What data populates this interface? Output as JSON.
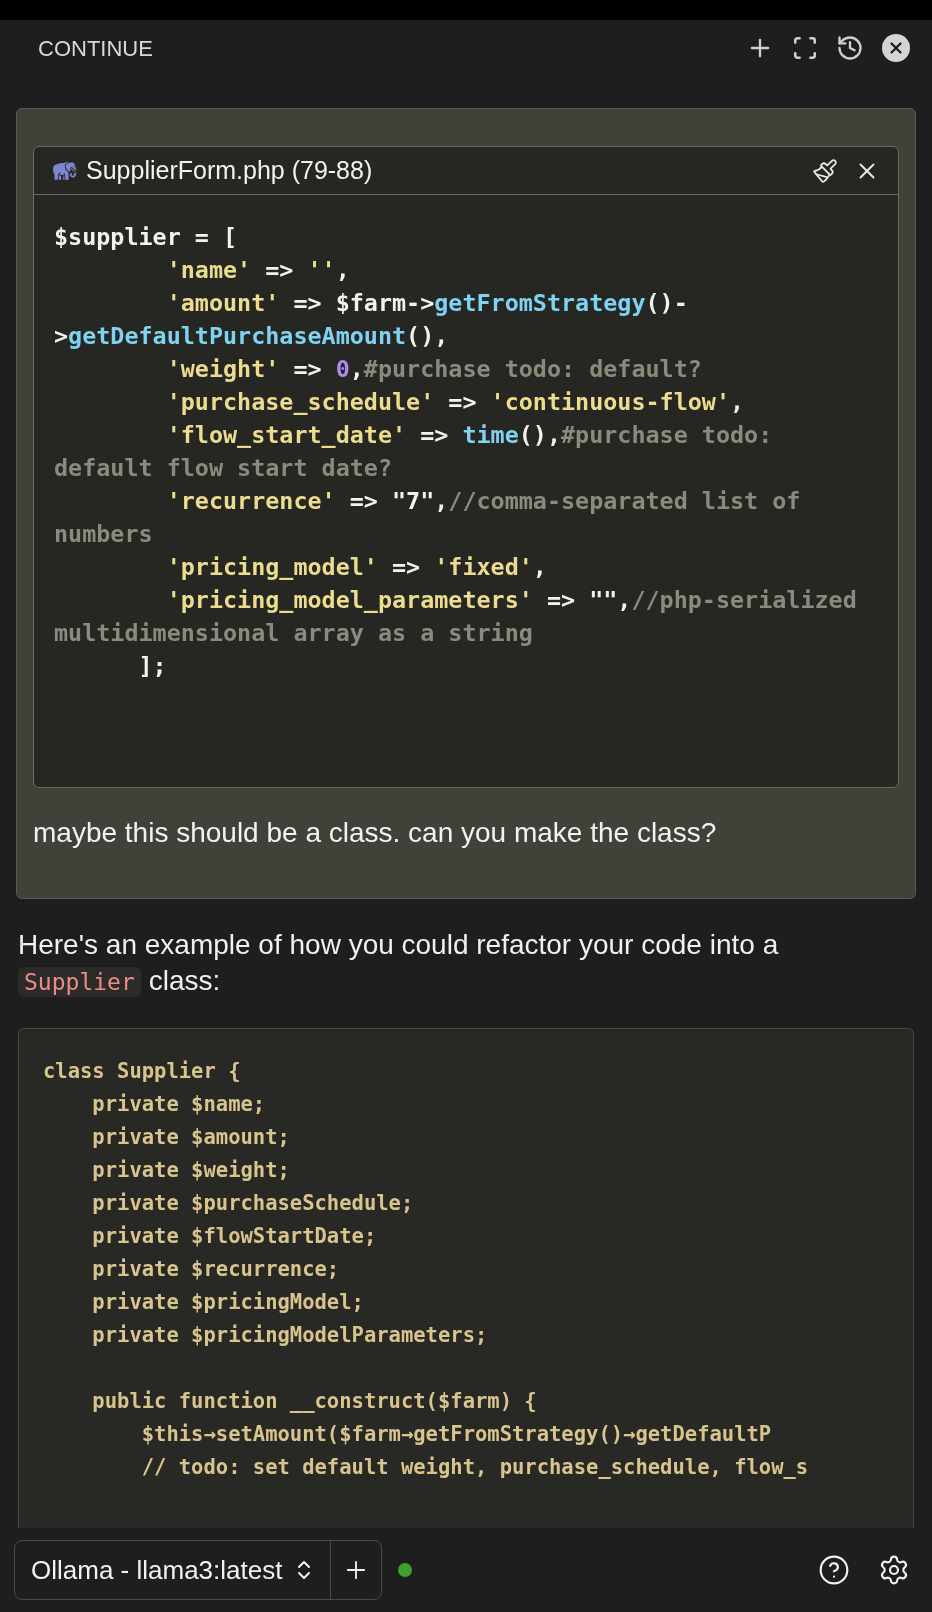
{
  "header": {
    "title": "CONTINUE"
  },
  "user_message": {
    "context": {
      "filename": "SupplierForm.php (79-88)",
      "code_lines": [
        {
          "indented": false,
          "tokens": [
            {
              "kind": "plain",
              "text": "$supplier = ["
            }
          ]
        },
        {
          "indented": true,
          "tokens": [
            {
              "kind": "string",
              "text": "'name'"
            },
            {
              "kind": "plain",
              "text": " => "
            },
            {
              "kind": "string",
              "text": "''"
            },
            {
              "kind": "plain",
              "text": ","
            }
          ]
        },
        {
          "indented": true,
          "tokens": [
            {
              "kind": "string",
              "text": "'amount'"
            },
            {
              "kind": "plain",
              "text": " => $farm->"
            },
            {
              "kind": "func",
              "text": "getFromStrategy"
            },
            {
              "kind": "plain",
              "text": "()-"
            }
          ]
        },
        {
          "indented": false,
          "tokens": [
            {
              "kind": "plain",
              "text": ">"
            },
            {
              "kind": "func",
              "text": "getDefaultPurchaseAmount"
            },
            {
              "kind": "plain",
              "text": "(),"
            }
          ]
        },
        {
          "indented": true,
          "tokens": [
            {
              "kind": "string",
              "text": "'weight'"
            },
            {
              "kind": "plain",
              "text": " => "
            },
            {
              "kind": "number",
              "text": "0"
            },
            {
              "kind": "plain",
              "text": ","
            },
            {
              "kind": "comment",
              "text": "#purchase todo: default?"
            }
          ]
        },
        {
          "indented": true,
          "tokens": [
            {
              "kind": "string",
              "text": "'purchase_schedule'"
            },
            {
              "kind": "plain",
              "text": " => "
            },
            {
              "kind": "string",
              "text": "'continuous-flow'"
            },
            {
              "kind": "plain",
              "text": ","
            }
          ]
        },
        {
          "indented": true,
          "tokens": [
            {
              "kind": "string",
              "text": "'flow_start_date'"
            },
            {
              "kind": "plain",
              "text": " => "
            },
            {
              "kind": "func",
              "text": "time"
            },
            {
              "kind": "plain",
              "text": "(),"
            },
            {
              "kind": "comment",
              "text": "#purchase todo:"
            }
          ]
        },
        {
          "indented": false,
          "tokens": [
            {
              "kind": "comment",
              "text": "default flow start date?"
            }
          ]
        },
        {
          "indented": true,
          "tokens": [
            {
              "kind": "string",
              "text": "'recurrence'"
            },
            {
              "kind": "plain",
              "text": " => \"7\","
            },
            {
              "kind": "comment",
              "text": "//comma-separated list of"
            }
          ]
        },
        {
          "indented": false,
          "tokens": [
            {
              "kind": "comment",
              "text": "numbers"
            }
          ]
        },
        {
          "indented": true,
          "tokens": [
            {
              "kind": "string",
              "text": "'pricing_model'"
            },
            {
              "kind": "plain",
              "text": " => "
            },
            {
              "kind": "string",
              "text": "'fixed'"
            },
            {
              "kind": "plain",
              "text": ","
            }
          ]
        },
        {
          "indented": true,
          "tokens": [
            {
              "kind": "string",
              "text": "'pricing_model_parameters'"
            },
            {
              "kind": "plain",
              "text": " => \"\","
            },
            {
              "kind": "comment",
              "text": "//php-serialized"
            }
          ]
        },
        {
          "indented": false,
          "tokens": [
            {
              "kind": "comment",
              "text": "multidimensional array as a string"
            }
          ]
        },
        {
          "indented": false,
          "tokens": [
            {
              "kind": "plain",
              "text": "      ];"
            }
          ]
        }
      ]
    },
    "text": "maybe this should be a class. can you make the class?"
  },
  "response": {
    "intro": [
      {
        "kind": "text",
        "text": "Here's an example of how you could refactor your code into a"
      },
      {
        "kind": "code",
        "text": "Supplier"
      },
      {
        "kind": "text",
        "text": "class:"
      }
    ],
    "code_lines": [
      {
        "text": "class Supplier {",
        "blank_before": false
      },
      {
        "text": "    private $name;",
        "blank_before": false
      },
      {
        "text": "    private $amount;",
        "blank_before": false
      },
      {
        "text": "    private $weight;",
        "blank_before": false
      },
      {
        "text": "    private $purchaseSchedule;",
        "blank_before": false
      },
      {
        "text": "    private $flowStartDate;",
        "blank_before": false
      },
      {
        "text": "    private $recurrence;",
        "blank_before": false
      },
      {
        "text": "    private $pricingModel;",
        "blank_before": false
      },
      {
        "text": "    private $pricingModelParameters;",
        "blank_before": false
      },
      {
        "text": "    public function __construct($farm) {",
        "blank_before": true
      },
      {
        "text": "        $this→setAmount($farm→getFromStrategy()→getDefaultP",
        "blank_before": false
      },
      {
        "text": "        // todo: set default weight, purchase_schedule, flow_s",
        "blank_before": false
      }
    ]
  },
  "footer": {
    "model": "Ollama - llama3:latest"
  }
}
